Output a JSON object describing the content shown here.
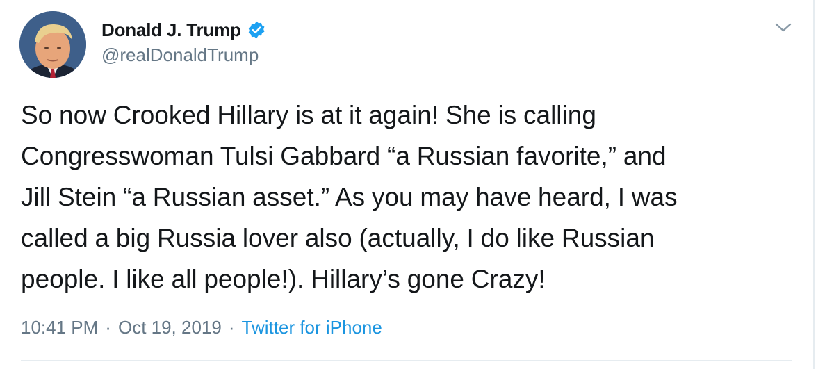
{
  "author": {
    "display_name": "Donald J. Trump",
    "handle": "@realDonaldTrump",
    "verified": true,
    "avatar_icon": "profile-photo",
    "verified_icon": "verified-badge-icon"
  },
  "tweet": {
    "lines": [
      "So now Crooked Hillary is at it again! She is calling",
      "Congresswoman Tulsi Gabbard “a Russian favorite,” and",
      "Jill Stein “a Russian asset.” As you may have heard, I was",
      "called a big Russia lover also (actually, I do like Russian",
      "people. I like all people!). Hillary’s gone Crazy!"
    ]
  },
  "meta": {
    "time": "10:41 PM",
    "separator": "·",
    "date": "Oct 19, 2019",
    "source": "Twitter for iPhone"
  },
  "menu": {
    "icon": "chevron-down-icon"
  },
  "colors": {
    "text": "#14171a",
    "secondary": "#657786",
    "accent": "#1b95e0",
    "verified": "#1da1f2",
    "border": "#e6ecf0"
  }
}
